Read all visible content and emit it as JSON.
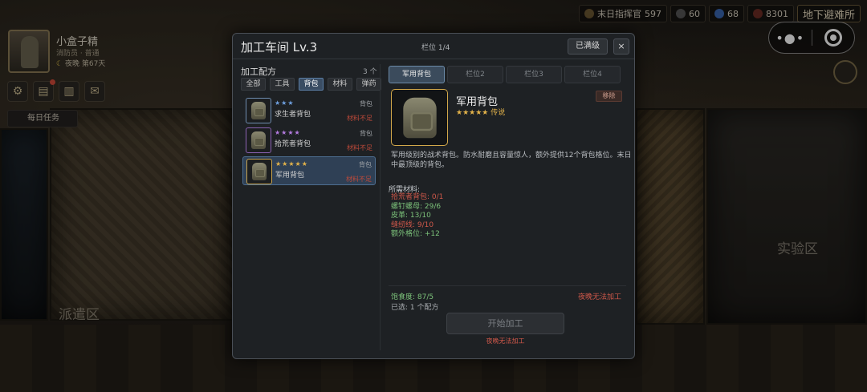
{
  "hud": {
    "player_name": "小盒子精",
    "player_role": "消防员 · 普通",
    "night_label": "夜晚",
    "day_label": "第67天",
    "daily_tasks": "每日任务",
    "resources": [
      {
        "label": "末日指挥官",
        "value": "597"
      },
      {
        "value": "60"
      },
      {
        "value": "68"
      },
      {
        "value": "8301"
      }
    ],
    "shelter_label": "地下避难所",
    "zone_dispatch": "派遣区",
    "zone_lab": "实验区"
  },
  "modal": {
    "title": "加工车间  Lv.3",
    "slot_count": "栏位 1/4",
    "maxed_label": "已满级",
    "close_label": "×",
    "recipes_title": "加工配方",
    "recipes_count": "3 个",
    "filters": [
      "全部",
      "工具",
      "背包",
      "材料",
      "弹药"
    ],
    "active_filter": "背包",
    "recipes": [
      {
        "stars": "★★★",
        "name": "求生者背包",
        "category": "背包",
        "status": "材料不足",
        "star_color": "#6fa0e0"
      },
      {
        "stars": "★★★★",
        "name": "拾荒者背包",
        "category": "背包",
        "status": "材料不足",
        "star_color": "#b47be0"
      },
      {
        "stars": "★★★★★",
        "name": "军用背包",
        "category": "背包",
        "status": "材料不足",
        "star_color": "#e2b24a"
      }
    ],
    "slots": [
      "军用背包",
      "栏位2",
      "栏位3",
      "栏位4"
    ],
    "selected_item": {
      "name": "军用背包",
      "rarity": "★★★★★ 传说",
      "remove_label": "移除",
      "description": "军用级别的战术背包。防水耐磨且容量惊人，额外提供12个背包格位。末日中最顶级的背包。"
    },
    "materials_title": "所需材料:",
    "materials": [
      {
        "text": "拾荒者背包: 0/1",
        "ok": false
      },
      {
        "text": "螺钉螺母: 29/6",
        "ok": true
      },
      {
        "text": "皮革: 13/10",
        "ok": true
      },
      {
        "text": "缝纫线: 9/10",
        "ok": false
      },
      {
        "text": "额外格位: +12",
        "ok": true
      }
    ],
    "satiety": "饱食度: 87/5",
    "chosen": "已选: 1 个配方",
    "night_warning": "夜晚无法加工",
    "start_label": "开始加工",
    "start_warning": "夜晚无法加工"
  }
}
